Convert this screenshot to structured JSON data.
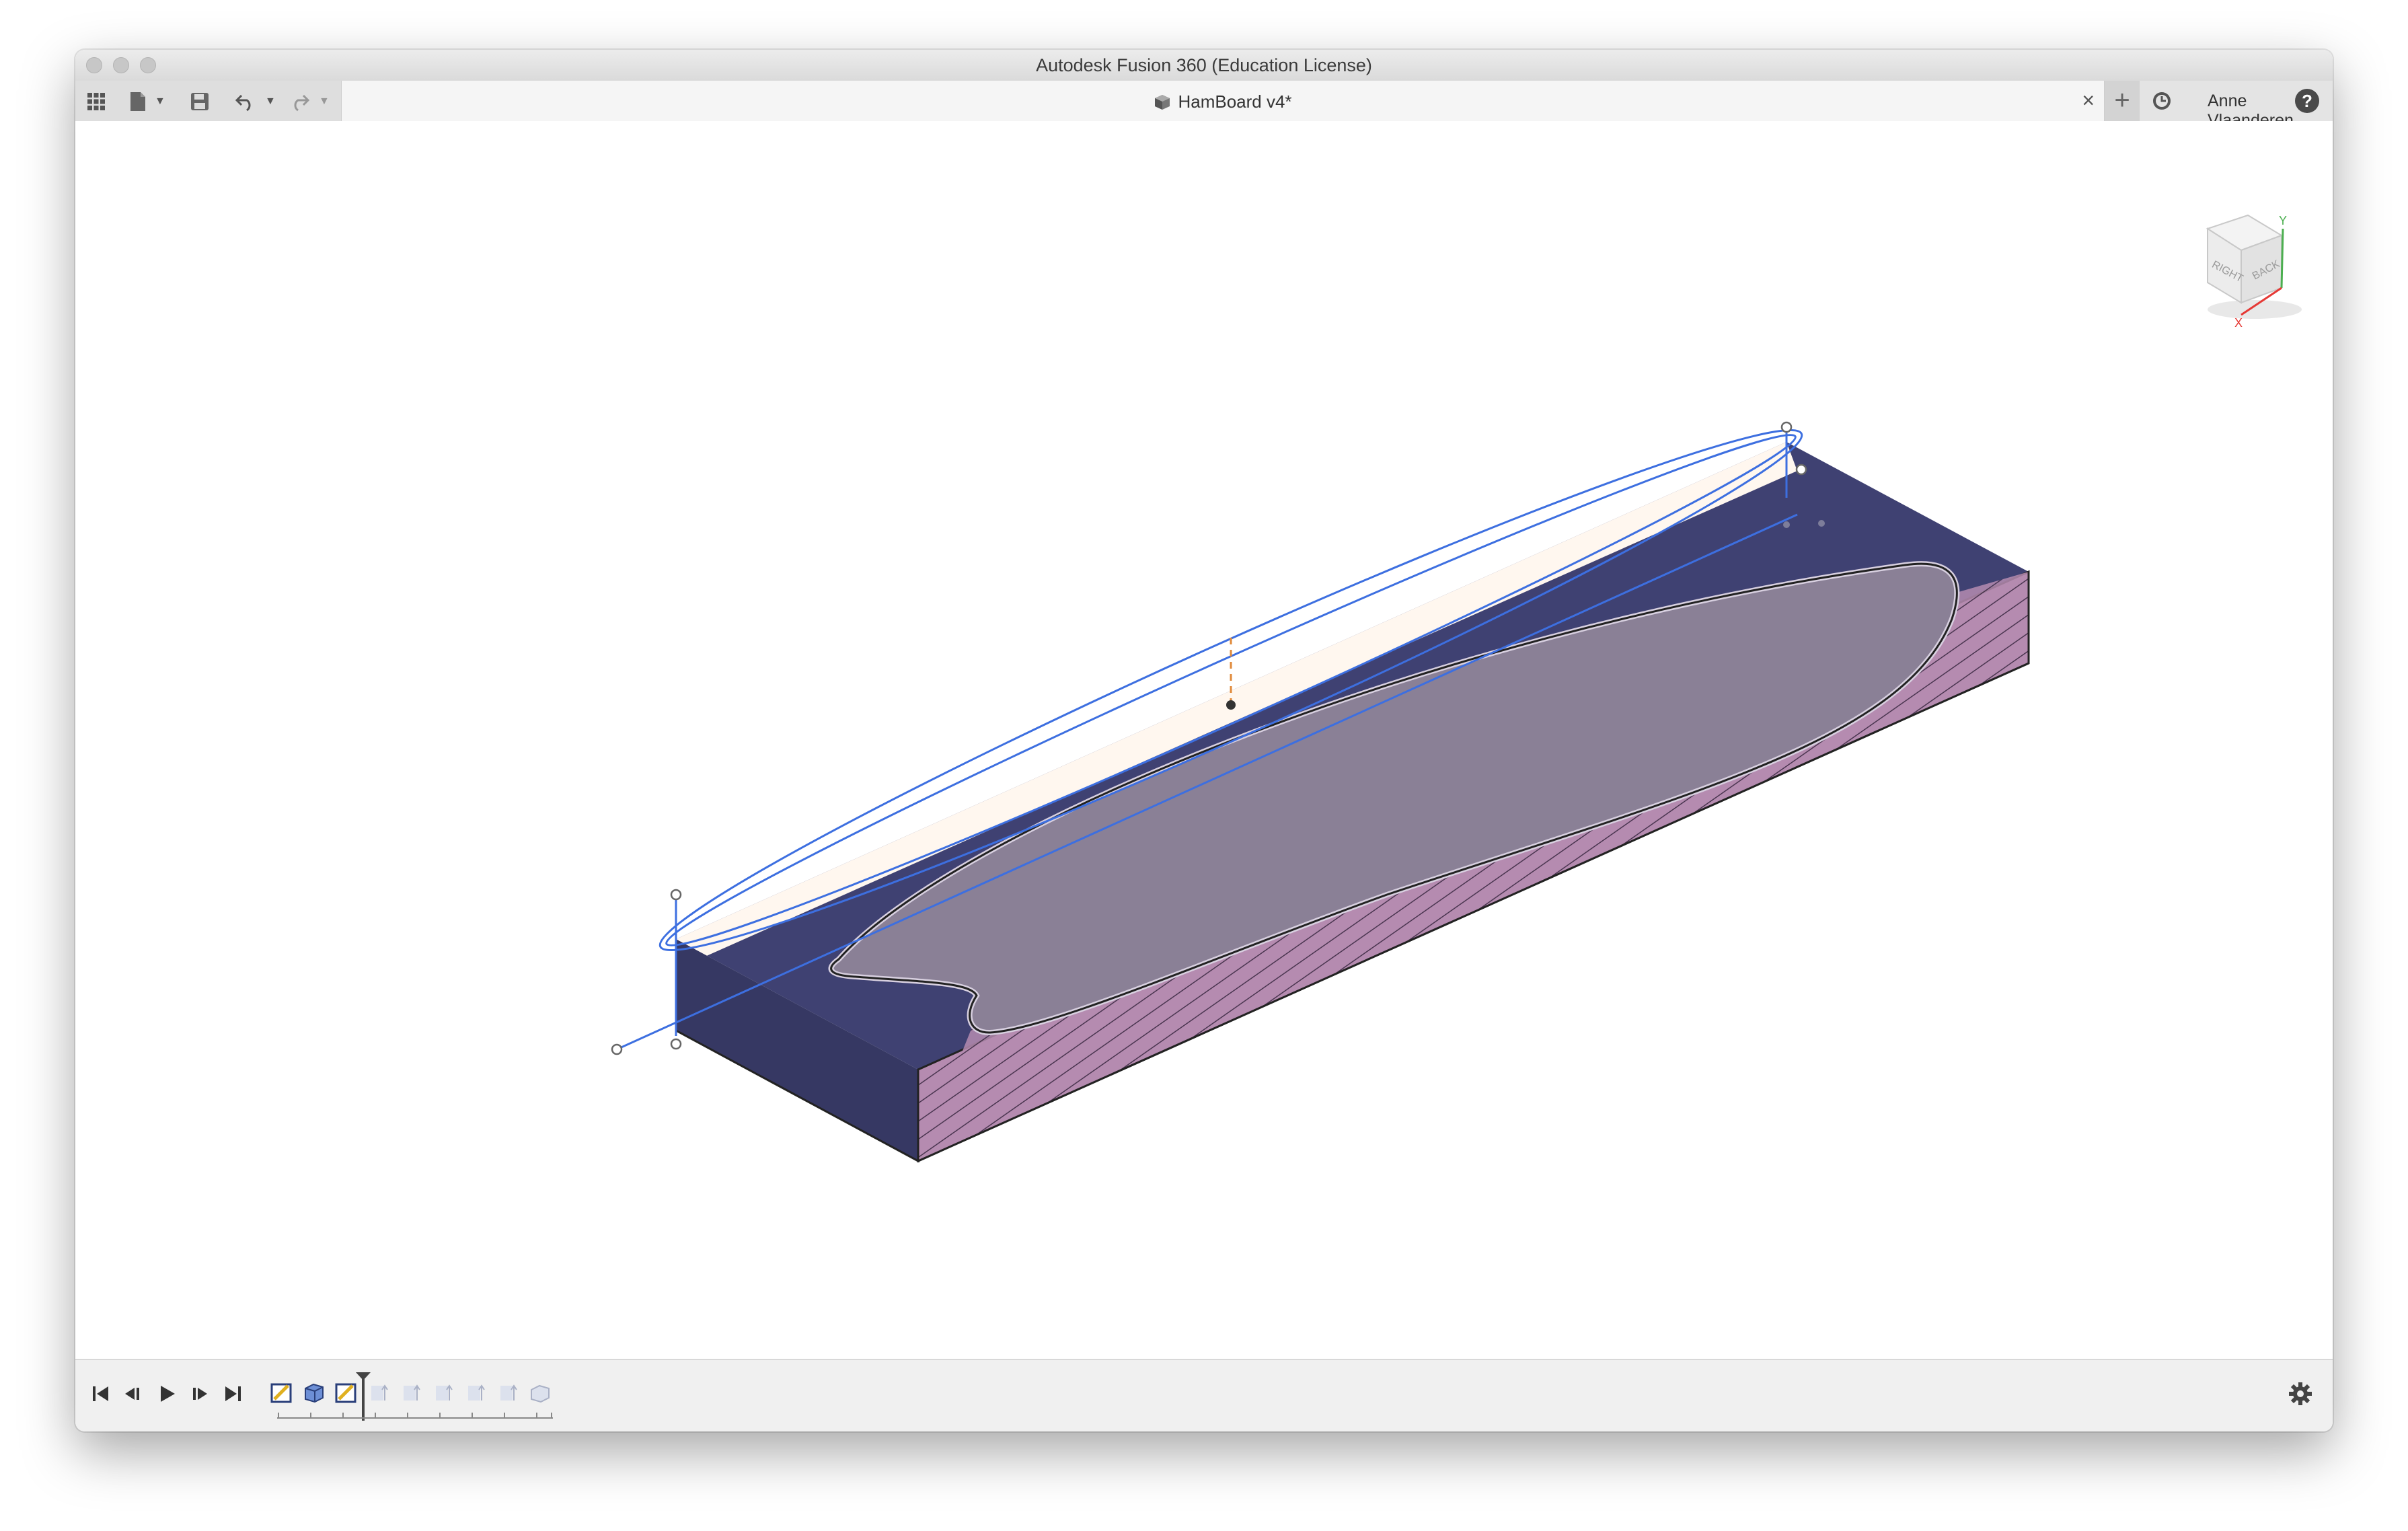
{
  "window": {
    "title": "Autodesk Fusion 360 (Education License)"
  },
  "toolbar": {
    "grid_icon": "app-grid-icon",
    "file_icon": "file-icon",
    "save_icon": "save-icon",
    "undo_icon": "undo-icon",
    "redo_icon": "redo-icon"
  },
  "document_tab": {
    "label": "HamBoard v4*",
    "icon": "component-cube-icon",
    "close_icon": "close-icon"
  },
  "header_right": {
    "new_tab_icon": "plus-icon",
    "job_status_icon": "clock-icon",
    "user_name": "Anne Vlaanderen",
    "help_label": "?"
  },
  "viewcube": {
    "face_right": "RIGHT",
    "face_back": "BACK",
    "axis_x": "X",
    "axis_y": "Y"
  },
  "colors": {
    "body_face": "#3b3e6e",
    "section_face": "#b58bb0",
    "sketch_line": "#3d6fe0",
    "profile_fill": "#8a8096",
    "cream_face": "#fff7ef"
  },
  "timeline": {
    "controls": [
      "skip-to-start-icon",
      "step-back-icon",
      "play-icon",
      "step-forward-icon",
      "skip-to-end-icon"
    ],
    "features": [
      "sketch-feature-icon",
      "extrude-feature-icon",
      "sketch-feature-icon",
      "suppressed-feature-icon",
      "suppressed-feature-icon",
      "suppressed-feature-icon",
      "suppressed-feature-icon",
      "suppressed-feature-icon",
      "suppressed-feature-icon"
    ],
    "settings_icon": "gear-icon"
  }
}
